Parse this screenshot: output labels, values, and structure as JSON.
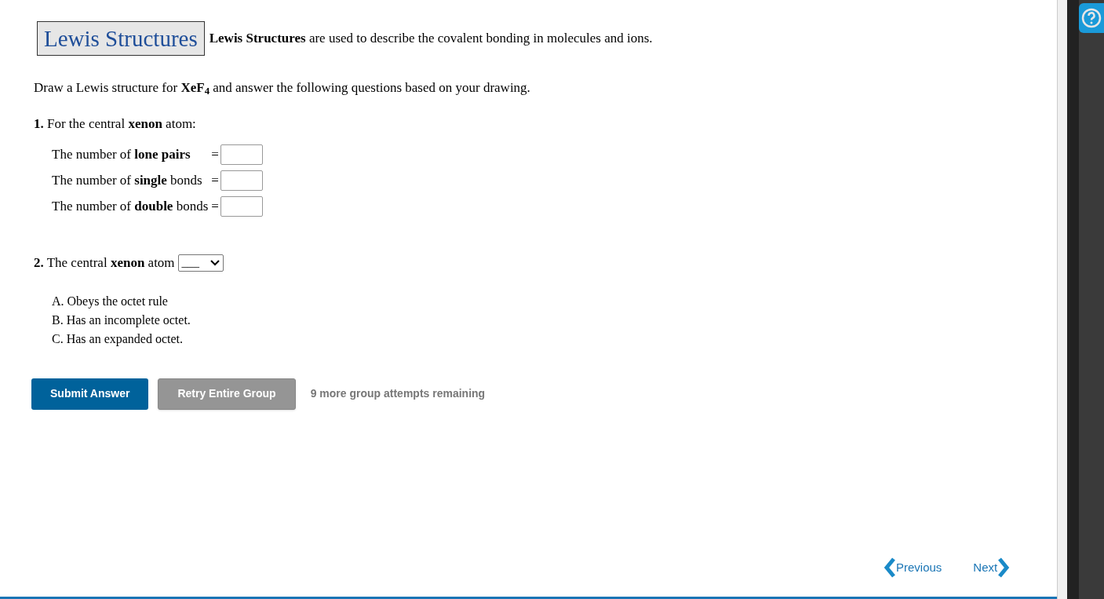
{
  "intro": {
    "badge": "Lewis Structures",
    "text": "**Lewis Structures** are used to describe the covalent bonding in molecules and ions."
  },
  "prompt": "Draw a Lewis structure for **XeF$_{4}$** and answer the following questions based on your drawing.",
  "question_1": {
    "text": "**1.** For the central **xenon** atom:",
    "rows": [
      {
        "label": "The number of **lone pairs**",
        "equals": "=",
        "value": ""
      },
      {
        "label": "The number of **single** bonds",
        "equals": "=",
        "value": ""
      },
      {
        "label": "The number of **double** bonds",
        "equals": "=",
        "value": ""
      }
    ]
  },
  "question_2": {
    "text": "**2.** The central **xenon** atom",
    "dropdown": "___",
    "options": [
      "A. Obeys the octet rule",
      "B. Has an incomplete octet.",
      "C. Has an expanded octet."
    ]
  },
  "buttons": [
    {
      "label": "Submit Answer",
      "kind": "primary"
    },
    {
      "label": "Retry Entire Group",
      "kind": "secondary"
    }
  ],
  "attempts": "9 more group attempts remaining",
  "nav": {
    "previous": "Previous",
    "next": "Next"
  }
}
